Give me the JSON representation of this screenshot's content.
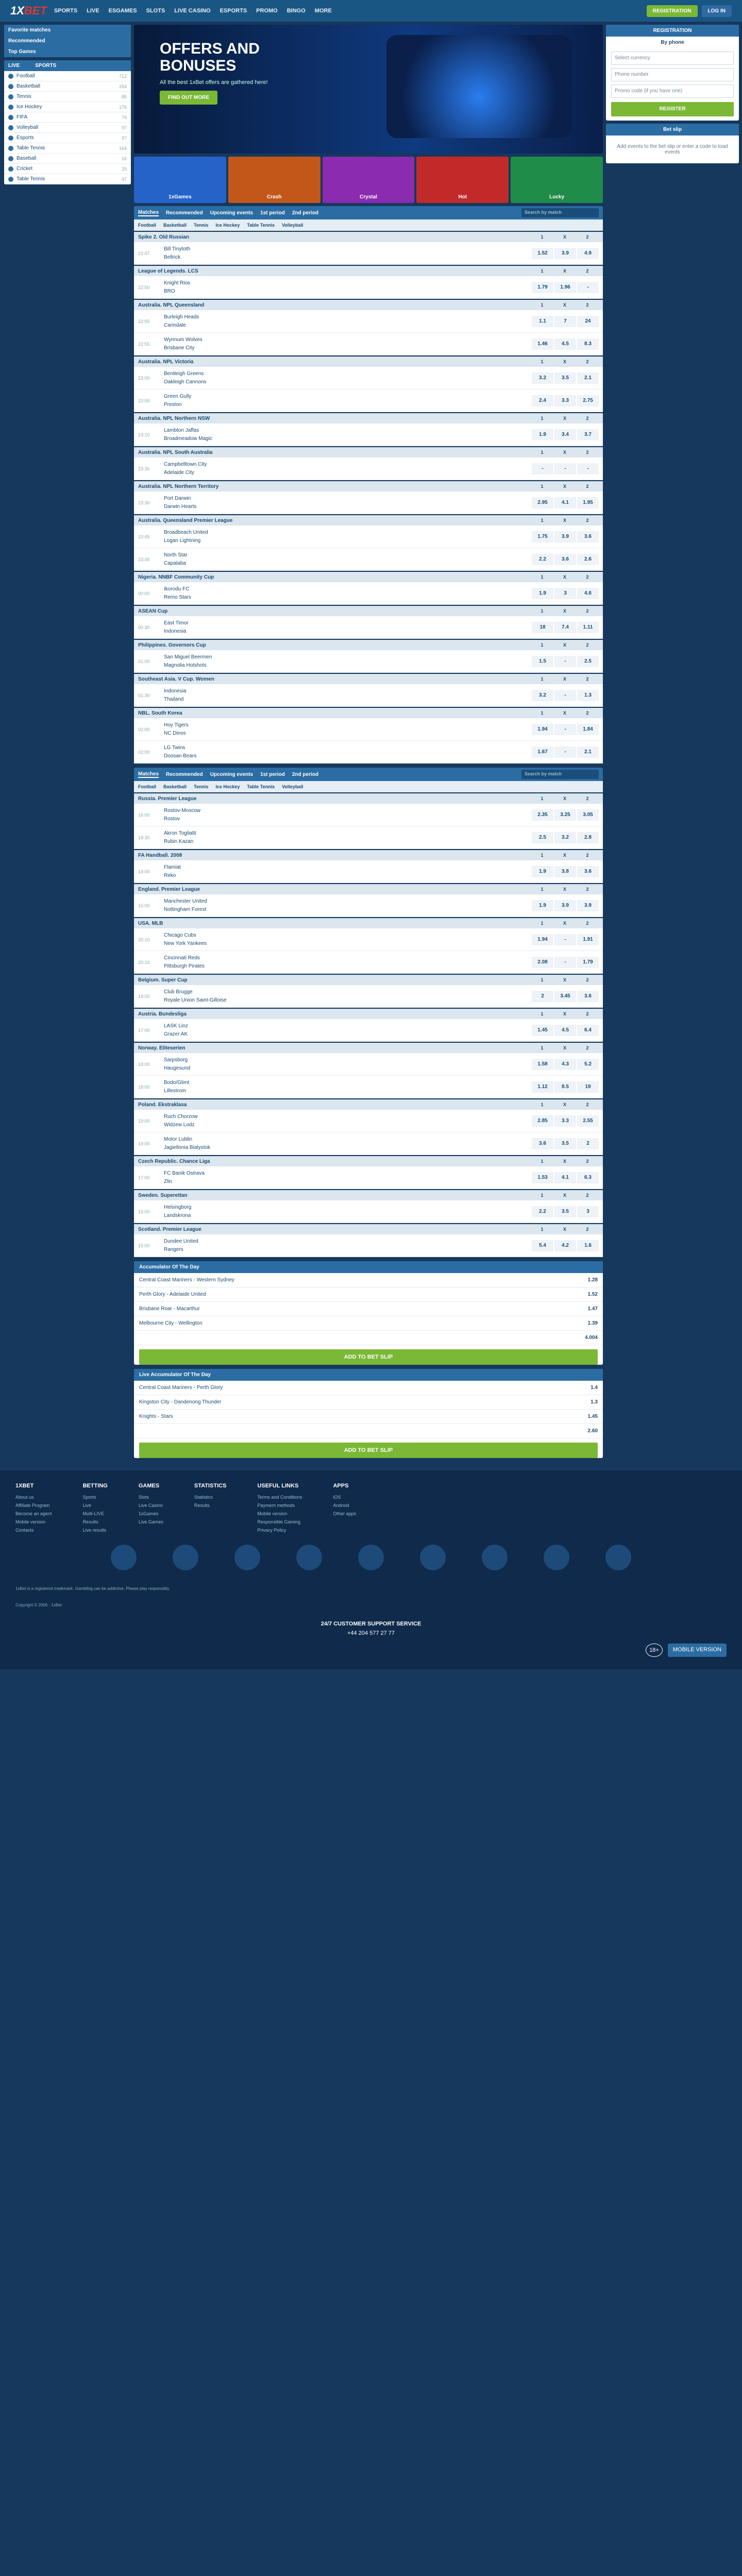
{
  "header": {
    "nav": [
      "SPORTS",
      "LIVE",
      "ESGAMES",
      "SLOTS",
      "LIVE CASINO",
      "ESPORTS",
      "PROMO",
      "BINGO",
      "MORE"
    ],
    "register": "REGISTRATION",
    "login": "LOG IN"
  },
  "left": {
    "fav": "Favorite matches",
    "rec": "Recommended",
    "top": "Top Games",
    "live": "LIVE",
    "sports": "SPORTS",
    "items": [
      {
        "n": "Football",
        "c": "712"
      },
      {
        "n": "Basketball",
        "c": "264"
      },
      {
        "n": "Tennis",
        "c": "85"
      },
      {
        "n": "Ice Hockey",
        "c": "176"
      },
      {
        "n": "FIFA",
        "c": "79"
      },
      {
        "n": "Volleyball",
        "c": "97"
      },
      {
        "n": "Esports",
        "c": "97"
      },
      {
        "n": "Table Tennis",
        "c": "164"
      },
      {
        "n": "Baseball",
        "c": "16"
      },
      {
        "n": "Cricket",
        "c": "29"
      },
      {
        "n": "Table Tennis",
        "c": "47"
      }
    ]
  },
  "banner": {
    "title": "OFFERS AND BONUSES",
    "sub": "All the best 1xBet offers are gathered here!",
    "cta": "FIND OUT MORE"
  },
  "games": [
    {
      "n": "1xGames",
      "c": "#2563c9"
    },
    {
      "n": "Crash",
      "c": "#c2571a"
    },
    {
      "n": "Crystal",
      "c": "#8a2bb0"
    },
    {
      "n": "Hot",
      "c": "#c22a2a"
    },
    {
      "n": "Lucky",
      "c": "#1f8c4a"
    }
  ],
  "tabs": [
    "Matches",
    "Recommended",
    "Upcoming events",
    "1st period",
    "2nd period"
  ],
  "search": "Search by match",
  "sports": [
    "Football",
    "Basketball",
    "Tennis",
    "Ice Hockey",
    "Table Tennis",
    "Volleyball"
  ],
  "oddcols": [
    "1",
    "X",
    "2",
    "1X",
    "12",
    "2X"
  ],
  "champs1": [
    {
      "n": "Spike 2. Old Russian",
      "m": [
        {
          "t": "22:47",
          "a": "Bill Tinytoth",
          "b": "Bellrick",
          "o": [
            "1.52",
            "3.9",
            "4.9"
          ]
        }
      ]
    },
    {
      "n": "League of Legends. LCS",
      "m": [
        {
          "t": "22:50",
          "a": "Knight Rios",
          "b": "BRO",
          "o": [
            "1.79",
            "1.96",
            "-"
          ]
        }
      ]
    },
    {
      "n": "Australia. NPL Queensland",
      "m": [
        {
          "t": "22:55",
          "a": "Burleigh Heads",
          "b": "Carindale",
          "o": [
            "1.1",
            "7",
            "24"
          ]
        },
        {
          "t": "22:55",
          "a": "Wynnum Wolves",
          "b": "Brisbane City",
          "o": [
            "1.46",
            "4.5",
            "8.3"
          ]
        }
      ]
    },
    {
      "n": "Australia. NPL Victoria",
      "m": [
        {
          "t": "23:00",
          "a": "Bentleigh Greens",
          "b": "Oakleigh Cannons",
          "o": [
            "3.2",
            "3.5",
            "2.1"
          ]
        },
        {
          "t": "23:00",
          "a": "Green Gully",
          "b": "Preston",
          "o": [
            "2.4",
            "3.3",
            "2.75"
          ]
        }
      ]
    },
    {
      "n": "Australia. NPL Northern NSW",
      "m": [
        {
          "t": "23:10",
          "a": "Lambton Jaffas",
          "b": "Broadmeadow Magic",
          "o": [
            "1.9",
            "3.4",
            "3.7"
          ]
        }
      ]
    },
    {
      "n": "Australia. NPL South Australia",
      "m": [
        {
          "t": "23:30",
          "a": "Campbelltown City",
          "b": "Adelaide City",
          "o": [
            "-",
            "-",
            "-"
          ]
        }
      ]
    },
    {
      "n": "Australia. NPL Northern Territory",
      "m": [
        {
          "t": "23:30",
          "a": "Port Darwin",
          "b": "Darwin Hearts",
          "o": [
            "2.95",
            "4.1",
            "1.95"
          ]
        }
      ]
    },
    {
      "n": "Australia. Queensland Premier League",
      "m": [
        {
          "t": "23:45",
          "a": "Broadbeach United",
          "b": "Logan Lightning",
          "o": [
            "1.75",
            "3.9",
            "3.6"
          ]
        },
        {
          "t": "23:45",
          "a": "North Star",
          "b": "Capalaba",
          "o": [
            "2.2",
            "3.6",
            "2.6"
          ]
        }
      ]
    },
    {
      "n": "Nigeria. NNBF Community Cup",
      "m": [
        {
          "t": "00:00",
          "a": "Ikorodu FC",
          "b": "Remo Stars",
          "o": [
            "1.9",
            "3",
            "4.6"
          ]
        }
      ]
    },
    {
      "n": "ASEAN Cup",
      "m": [
        {
          "t": "00:30",
          "a": "East Timor",
          "b": "Indonesia",
          "o": [
            "18",
            "7.4",
            "1.11"
          ]
        }
      ]
    },
    {
      "n": "Philippines. Governors Cup",
      "m": [
        {
          "t": "01:00",
          "a": "San Miguel Beermen",
          "b": "Magnolia Hotshots",
          "o": [
            "1.5",
            "-",
            "2.5"
          ]
        }
      ]
    },
    {
      "n": "Southeast Asia. V Cup. Women",
      "m": [
        {
          "t": "01:30",
          "a": "Indonesia",
          "b": "Thailand",
          "o": [
            "3.2",
            "-",
            "1.3"
          ]
        }
      ]
    },
    {
      "n": "NBL. South Korea",
      "m": [
        {
          "t": "02:00",
          "a": "Hoy Tigers",
          "b": "NC Dinos",
          "o": [
            "1.94",
            "-",
            "1.84"
          ]
        },
        {
          "t": "02:00",
          "a": "LG Twins",
          "b": "Doosan Bears",
          "o": [
            "1.67",
            "-",
            "2.1"
          ]
        }
      ]
    }
  ],
  "champs2": [
    {
      "n": "Russia. Premier League",
      "m": [
        {
          "t": "16:00",
          "a": "Rostov-Moscow",
          "b": "Rostov",
          "o": [
            "2.35",
            "3.25",
            "3.05"
          ]
        },
        {
          "t": "18:30",
          "a": "Akron Togliatti",
          "b": "Rubin Kazan",
          "o": [
            "2.5",
            "3.2",
            "2.8"
          ]
        }
      ]
    },
    {
      "n": "FA Handball. 2008",
      "m": [
        {
          "t": "19:00",
          "a": "Flamiat",
          "b": "Reko",
          "o": [
            "1.9",
            "3.8",
            "3.6"
          ]
        }
      ]
    },
    {
      "n": "England. Premier League",
      "m": [
        {
          "t": "15:00",
          "a": "Manchester United",
          "b": "Nottingham Forest",
          "o": [
            "1.9",
            "3.9",
            "3.9"
          ]
        }
      ]
    },
    {
      "n": "USA. MLB",
      "m": [
        {
          "t": "20:10",
          "a": "Chicago Cubs",
          "b": "New York Yankees",
          "o": [
            "1.94",
            "-",
            "1.91"
          ]
        },
        {
          "t": "20:10",
          "a": "Cincinnati Reds",
          "b": "Pittsburgh Pirates",
          "o": [
            "2.08",
            "-",
            "1.79"
          ]
        }
      ]
    },
    {
      "n": "Belgium. Super Cup",
      "m": [
        {
          "t": "19:00",
          "a": "Club Brugge",
          "b": "Royale Union Saint-Gilloise",
          "o": [
            "2",
            "3.45",
            "3.6"
          ]
        }
      ]
    },
    {
      "n": "Austria. Bundesliga",
      "m": [
        {
          "t": "17:00",
          "a": "LASK Linz",
          "b": "Grazer AK",
          "o": [
            "1.45",
            "4.5",
            "6.4"
          ]
        }
      ]
    },
    {
      "n": "Norway. Eliteserien",
      "m": [
        {
          "t": "18:00",
          "a": "Sarpsborg",
          "b": "Haugesund",
          "o": [
            "1.58",
            "4.3",
            "5.2"
          ]
        },
        {
          "t": "18:00",
          "a": "Bodo/Glimt",
          "b": "Lillestrom",
          "o": [
            "1.12",
            "8.5",
            "19"
          ]
        }
      ]
    },
    {
      "n": "Poland. Ekstraklasa",
      "m": [
        {
          "t": "19:00",
          "a": "Ruch Chorzow",
          "b": "Widzew Lodz",
          "o": [
            "2.85",
            "3.3",
            "2.55"
          ]
        },
        {
          "t": "19:00",
          "a": "Motor Lublin",
          "b": "Jagiellonia Bialystok",
          "o": [
            "3.6",
            "3.5",
            "2"
          ]
        }
      ]
    },
    {
      "n": "Czech Republic. Chance Liga",
      "m": [
        {
          "t": "17:00",
          "a": "FC Banik Ostrava",
          "b": "Zlin",
          "o": [
            "1.53",
            "4.1",
            "6.3"
          ]
        }
      ]
    },
    {
      "n": "Sweden. Superettan",
      "m": [
        {
          "t": "15:00",
          "a": "Helsingborg",
          "b": "Landskrona",
          "o": [
            "2.2",
            "3.5",
            "3"
          ]
        }
      ]
    },
    {
      "n": "Scotland. Premier League",
      "m": [
        {
          "t": "15:00",
          "a": "Dundee United",
          "b": "Rangers",
          "o": [
            "5.4",
            "4.2",
            "1.6"
          ]
        }
      ]
    }
  ],
  "acc1": {
    "t": "Accumulator Of The Day",
    "rows": [
      {
        "e": "Central Coast Mariners - Western Sydney",
        "o": "1.28"
      },
      {
        "e": "Perth Glory - Adelaide United",
        "o": "1.52"
      },
      {
        "e": "Brisbane Roar - Macarthur",
        "o": "1.47"
      },
      {
        "e": "Melbourne City - Wellington",
        "o": "1.39"
      }
    ],
    "total": "4.004",
    "add": "ADD TO BET SLIP"
  },
  "acc2": {
    "t": "Live Accumulator Of The Day",
    "rows": [
      {
        "e": "Central Coast Mariners - Perth Glory",
        "o": "1.4"
      },
      {
        "e": "Kingston City - Dandenong Thunder",
        "o": "1.3"
      },
      {
        "e": "Knights - Stars",
        "o": "1.45"
      }
    ],
    "total": "2.60",
    "add": "ADD TO BET SLIP"
  },
  "right": {
    "reg": "REGISTRATION",
    "by": "By phone",
    "field1": "Select currency",
    "field2": "Phone number",
    "field3": "Promo code (if you have one)",
    "btn": "REGISTER",
    "slip": "Bet slip",
    "empty": "Add events to the bet slip or enter a code to load events"
  },
  "footer": {
    "cols": [
      {
        "h": "1XBET",
        "i": [
          "About us",
          "Affiliate Program",
          "Become an agent",
          "Mobile version",
          "Contacts"
        ]
      },
      {
        "h": "BETTING",
        "i": [
          "Sports",
          "Live",
          "Multi-LIVE",
          "Results",
          "Live results"
        ]
      },
      {
        "h": "GAMES",
        "i": [
          "Slots",
          "Live Casino",
          "1xGames",
          "Live Games"
        ]
      },
      {
        "h": "STATISTICS",
        "i": [
          "Statistics",
          "Results"
        ]
      },
      {
        "h": "USEFUL LINKS",
        "i": [
          "Terms and Conditions",
          "Payment methods",
          "Mobile version",
          "Responsible Gaming",
          "Privacy Policy"
        ]
      },
      {
        "h": "APPS",
        "i": [
          "iOS",
          "Android",
          "Other apps"
        ]
      }
    ],
    "legal": "1xBet is a registered trademark. Gambling can be addictive. Please play responsibly.",
    "copy": "Copyright © 2006 - 1xBet",
    "support": "24/7 CUSTOMER SUPPORT SERVICE",
    "phone": "+44 204 577 27 77",
    "age": "18+",
    "mobile": "MOBILE VERSION"
  }
}
